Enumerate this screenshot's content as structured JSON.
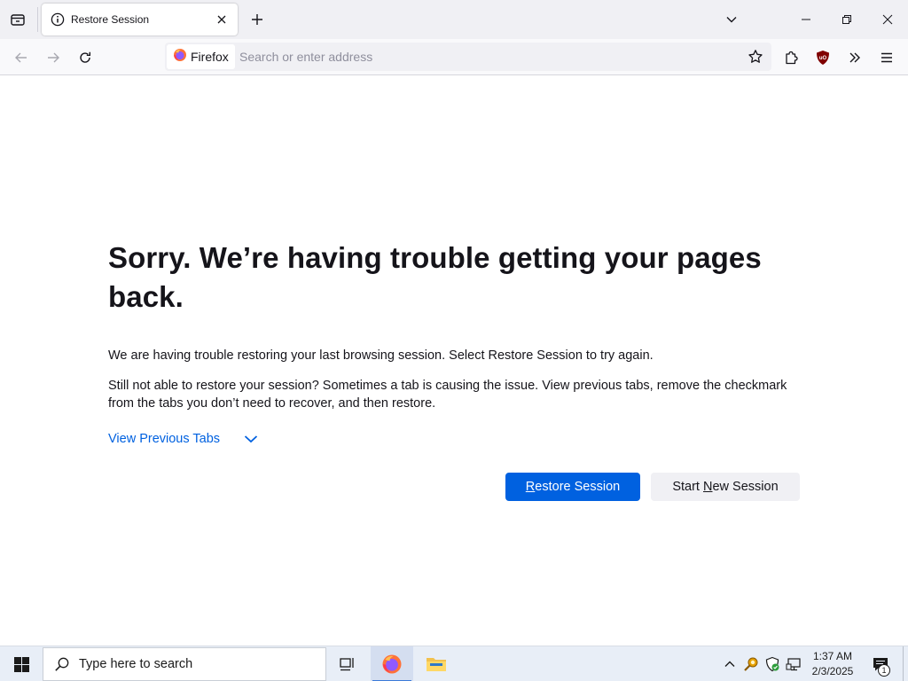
{
  "browser": {
    "tab": {
      "title": "Restore Session"
    },
    "urlbar": {
      "identity_label": "Firefox",
      "placeholder": "Search or enter address",
      "value": ""
    }
  },
  "content": {
    "heading": "Sorry. We’re having trouble getting your pages back.",
    "description_1": "We are having trouble restoring your last browsing session. Select Restore Session to try again.",
    "description_2": "Still not able to restore your session? Sometimes a tab is causing the issue. View previous tabs, remove the checkmark from the tabs you don’t need to recover, and then restore.",
    "view_previous_tabs": "View Previous Tabs",
    "restore_button": {
      "accesskey": "R",
      "rest": "estore Session"
    },
    "new_session_button": {
      "before": "Start ",
      "accesskey": "N",
      "after": "ew Session"
    }
  },
  "taskbar": {
    "search_placeholder": "Type here to search",
    "clock_time": "1:37 AM",
    "clock_date": "2/3/2025",
    "notification_count": "1"
  },
  "colors": {
    "accent_blue": "#0061e0",
    "toolbar_bg": "#f9f9fb",
    "tabstrip_bg": "#f0f0f4",
    "ublock_red": "#800000",
    "taskbar_bg": "#e8eef7"
  },
  "icons": {
    "tab_list": "tab-list-icon",
    "tab_favicon": "info-icon",
    "tab_close": "close-icon",
    "new_tab": "plus-icon",
    "back": "arrow-left-icon",
    "forward": "arrow-right-icon",
    "reload": "reload-icon",
    "bookmark": "star-icon",
    "extensions": "puzzle-icon",
    "ublock": "ublock-shield-icon",
    "overflow": "chevron-double-right-icon",
    "menu": "hamburger-icon"
  }
}
